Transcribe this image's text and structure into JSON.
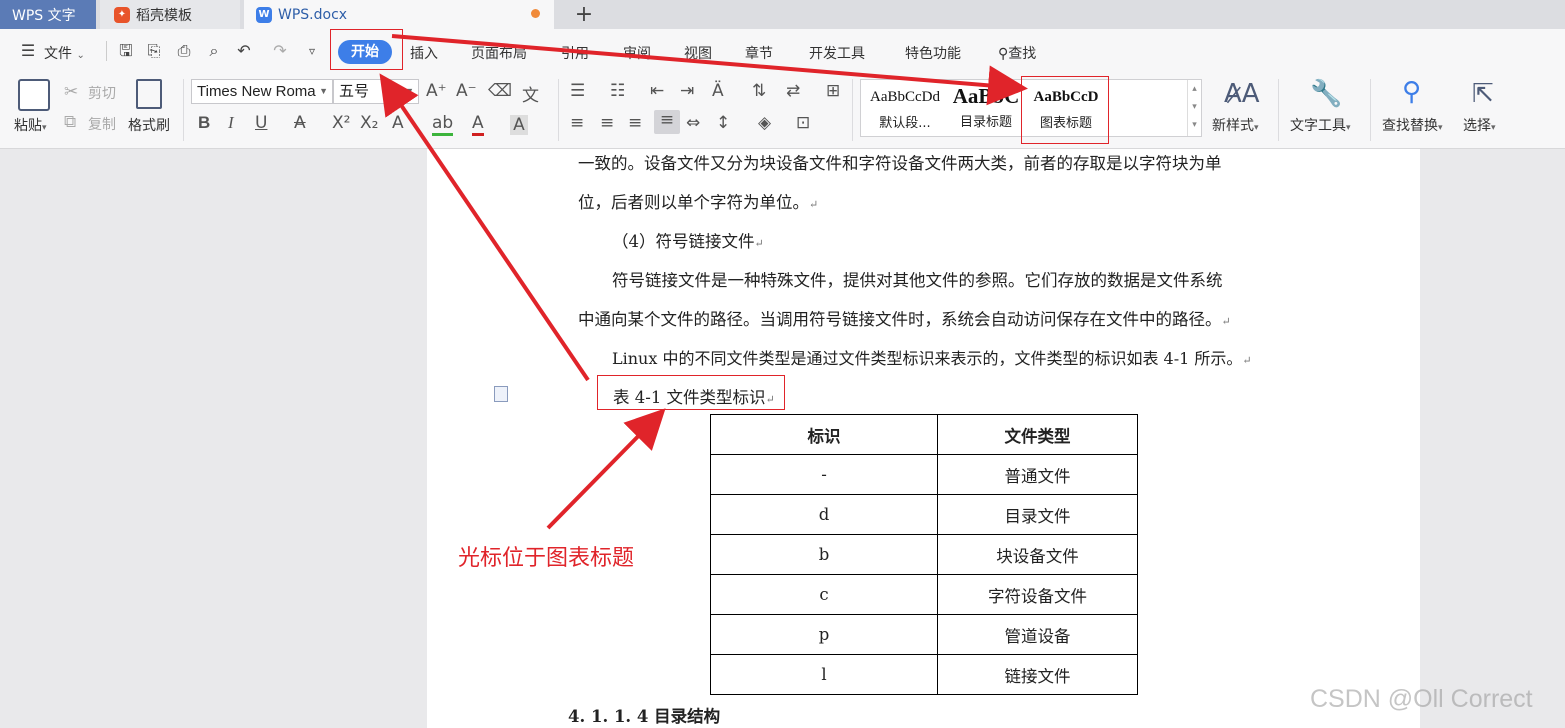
{
  "tabs": {
    "wps": "WPS 文字",
    "daoke": "稻壳模板",
    "doc": "WPS.docx",
    "new": "+"
  },
  "menu": {
    "file": "文件",
    "items": [
      "开始",
      "插入",
      "页面布局",
      "引用",
      "审阅",
      "视图",
      "章节",
      "开发工具",
      "特色功能",
      "查找"
    ]
  },
  "ribbon": {
    "paste": "粘贴",
    "cut": "剪切",
    "copy": "复制",
    "format_painter": "格式刷",
    "font_name": "Times New Roma",
    "font_size": "五号",
    "styles": [
      {
        "sample": "AaBbCcDd",
        "name": "默认段..."
      },
      {
        "sample": "AaBbC",
        "name": "目录标题"
      },
      {
        "sample": "AaBbCcD",
        "name": "图表标题"
      }
    ],
    "new_style": "新样式",
    "text_tools": "文字工具",
    "find_replace": "查找替换",
    "select": "选择"
  },
  "document": {
    "lines": [
      "一致的。设备文件又分为块设备文件和字符设备文件两大类，前者的存取是以字符块为单",
      "位，后者则以单个字符为单位。",
      "（4）符号链接文件",
      "符号链接文件是一种特殊文件，提供对其他文件的参照。它们存放的数据是文件系统",
      "中通向某个文件的路径。当调用符号链接文件时，系统会自动访问保存在文件中的路径。",
      "Linux 中的不同文件类型是通过文件类型标识来表示的，文件类型的标识如表 4-1 所示。"
    ],
    "caption": "表 4-1 文件类型标识",
    "table": {
      "headers": [
        "标识",
        "文件类型"
      ],
      "rows": [
        [
          "-",
          "普通文件"
        ],
        [
          "d",
          "目录文件"
        ],
        [
          "b",
          "块设备文件"
        ],
        [
          "c",
          "字符设备文件"
        ],
        [
          "p",
          "管道设备"
        ],
        [
          "l",
          "链接文件"
        ]
      ]
    },
    "heading": "4. 1. 1. 4 目录结构"
  },
  "annotation": "光标位于图表标题",
  "watermark": "CSDN @Oll Correct",
  "colors": {
    "accent": "#3d7ee8",
    "annotation": "#e0242a"
  }
}
